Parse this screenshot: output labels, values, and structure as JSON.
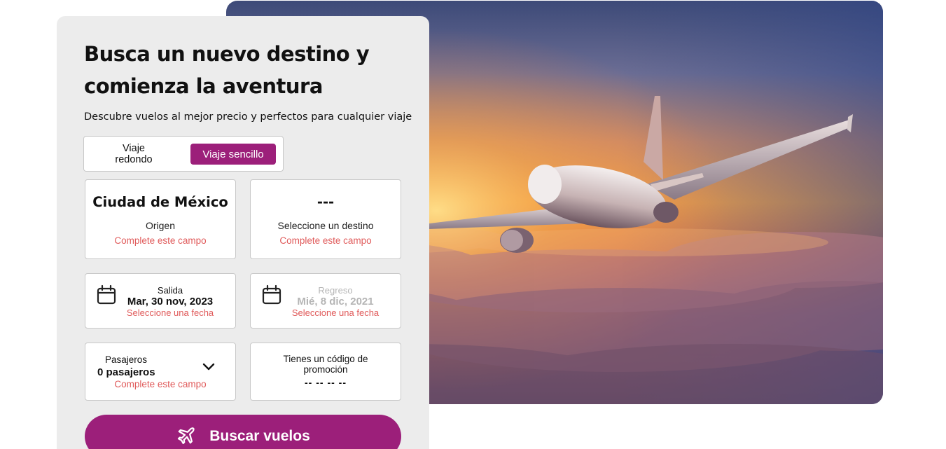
{
  "hero": {
    "image_icon": "airplane-over-clouds-photo"
  },
  "form": {
    "title": "Busca un nuevo destino y comienza la aventura",
    "subtitle": "Descubre vuelos al mejor precio y perfectos para cualquier viaje",
    "trip_type": {
      "round_trip_label": "Viaje redondo",
      "one_way_label": "Viaje sencillo",
      "selected": "Viaje sencillo"
    },
    "origin": {
      "value": "Ciudad de México",
      "label": "Origen",
      "error": "Complete este campo"
    },
    "destination": {
      "value": "---",
      "label": "Seleccione un destino",
      "error": "Complete este campo"
    },
    "departure": {
      "label": "Salida",
      "value": "Mar, 30 nov, 2023",
      "error": "Seleccione una fecha",
      "icon": "calendar-icon"
    },
    "return": {
      "label": "Regreso",
      "value": "Mié, 8 dic, 2021",
      "error": "Seleccione una fecha",
      "icon": "calendar-icon"
    },
    "passengers": {
      "label": "Pasajeros",
      "value": "0 pasajeros",
      "error": "Complete este campo",
      "icon": "chevron-down-icon"
    },
    "promo": {
      "label": "Tienes un código de promoción",
      "value": "-- -- -- --"
    },
    "search_button": {
      "label": "Buscar vuelos",
      "icon": "airplane-icon"
    }
  },
  "colors": {
    "accent": "#9c1f7a",
    "error": "#e05a5a",
    "panel": "#ececec"
  }
}
